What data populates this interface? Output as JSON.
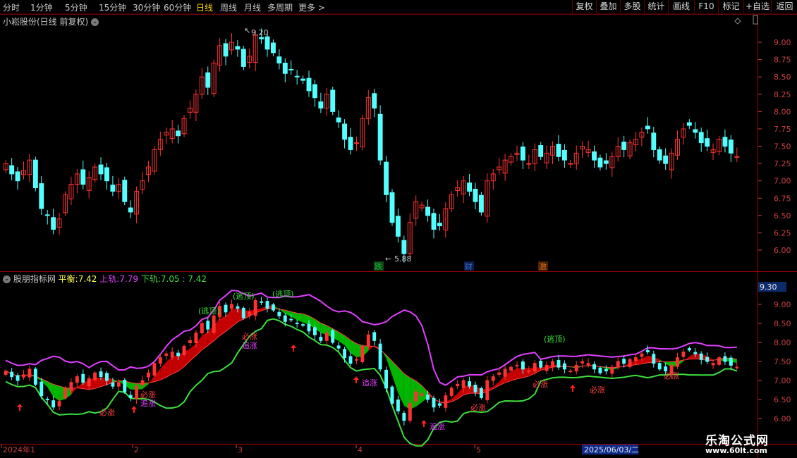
{
  "toolbar": {
    "periods": [
      "分时",
      "1分钟",
      "5分钟",
      "15分钟",
      "30分钟",
      "60分钟",
      "日线",
      "周线",
      "月线",
      "多周期",
      "更多 >"
    ],
    "active_period": "日线",
    "right_buttons": [
      "复权",
      "叠加",
      "多股",
      "统计",
      "画线",
      "F10",
      "标记",
      "+自选",
      "返回"
    ]
  },
  "main_panel": {
    "title": "小崧股份(日线 前复权)",
    "high_label": "9.20",
    "low_label": "5.88",
    "event_tags": [
      {
        "text": "跌",
        "color": "#1faa3a"
      },
      {
        "text": "财",
        "color": "#3b6ed8"
      },
      {
        "text": "激",
        "color": "#d2691e"
      }
    ],
    "y_ticks": [
      "9.00",
      "8.75",
      "8.50",
      "8.25",
      "8.00",
      "7.75",
      "7.50",
      "7.25",
      "7.00",
      "6.75",
      "6.50",
      "6.25",
      "6.00"
    ]
  },
  "indicator_panel": {
    "name": "股朋指标网",
    "balance_label": "平衡:",
    "balance_value": "7.42",
    "upper_label": "上轨:",
    "upper_value": "7.79",
    "lower_label": "下轨:",
    "lower_value": "7.05",
    "extra_value": ": 7.42",
    "cursor_value": "9.30",
    "y_ticks": [
      "9.00",
      "8.50",
      "8.00",
      "7.50",
      "7.00",
      "6.50",
      "6.00"
    ],
    "signals": [
      "(逃顶)",
      "(逃顶)",
      "(逃顶)",
      "(逃顶)",
      "必涨",
      "追涨",
      "必涨",
      "追涨",
      "必涨",
      "追涨",
      "追涨",
      "必涨",
      "必涨",
      "必涨",
      "必涨"
    ]
  },
  "date_axis": {
    "labels": [
      "2024年1",
      "2",
      "3",
      "4",
      "5"
    ],
    "cursor_date": "2025/06/03/二"
  },
  "watermark": {
    "title": "乐淘公式网",
    "url": "www.60lt.com"
  },
  "colors": {
    "up": "#ff3232",
    "down": "#54ffff",
    "upper_band": "#e040ff",
    "lower_band": "#3ce03c",
    "fill_up": "#d00000",
    "fill_down": "#00c000"
  }
}
